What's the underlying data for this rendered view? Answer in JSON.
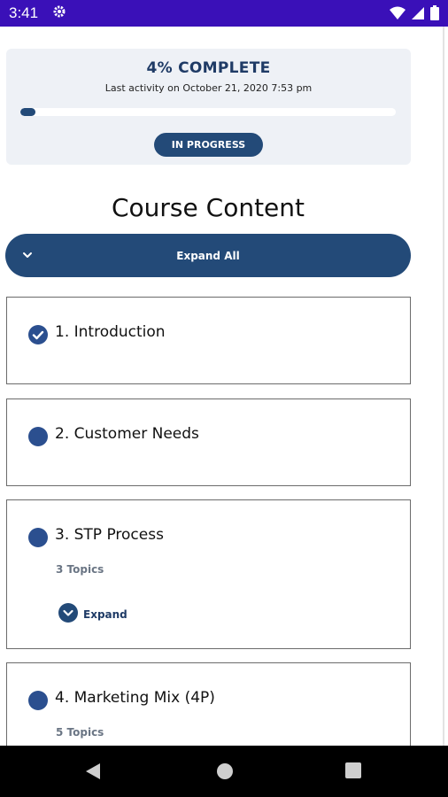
{
  "status_bar": {
    "time": "3:41"
  },
  "progress": {
    "percent_label": "4% COMPLETE",
    "last_activity": "Last activity on October 21, 2020 7:53 pm",
    "percent": 4,
    "status": "IN PROGRESS"
  },
  "course": {
    "title": "Course Content",
    "expand_all": "Expand All",
    "modules": [
      {
        "title": "1. Introduction",
        "completed": true
      },
      {
        "title": "2. Customer Needs",
        "completed": false
      },
      {
        "title": "3. STP Process",
        "completed": false,
        "topics": "3 Topics",
        "expand": "Expand"
      },
      {
        "title": "4. Marketing Mix (4P)",
        "completed": false,
        "topics": "5 Topics"
      }
    ]
  },
  "colors": {
    "status_bar": "#3a10b8",
    "accent": "#234a78",
    "card_bg": "#eef1f6"
  }
}
